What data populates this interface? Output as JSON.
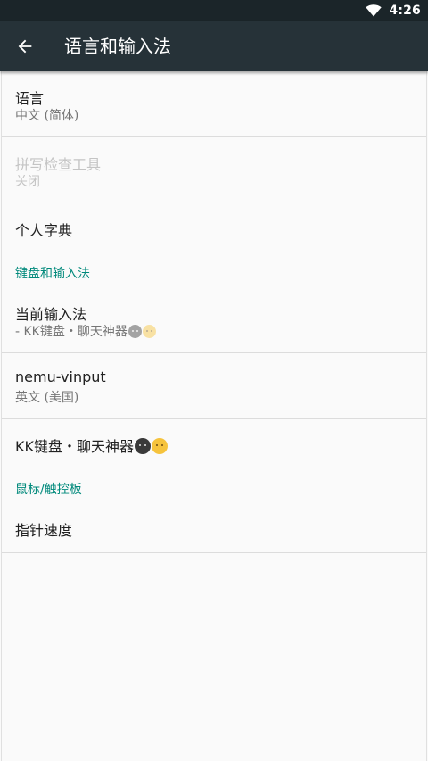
{
  "status_bar": {
    "time": "4:26",
    "icons": [
      "wifi-icon"
    ]
  },
  "app_bar": {
    "title": "语言和输入法",
    "back_icon": "arrow-back-icon"
  },
  "colors": {
    "status_bar": "#1b2529",
    "app_bar": "#263238",
    "accent": "#00897b",
    "background": "#fafafa"
  },
  "prefs": {
    "language": {
      "title": "语言",
      "summary": "中文 (简体)"
    },
    "spellcheck": {
      "title": "拼写检查工具",
      "summary": "关闭",
      "enabled": false
    },
    "dictionary": {
      "title": "个人字典"
    }
  },
  "keyboard_section": {
    "title": "键盘和输入法",
    "current_ime": {
      "title": "当前输入法",
      "summary": "- KK键盘・聊天神器",
      "emoji": [
        "dark-face-emoji",
        "yellow-face-emoji"
      ]
    },
    "nemu": {
      "title": "nemu-vinput",
      "summary": "英文 (美国)"
    },
    "kk": {
      "title": "KK键盘・聊天神器",
      "emoji": [
        "dark-face-emoji",
        "yellow-face-emoji"
      ]
    }
  },
  "pointer_section": {
    "title": "鼠标/触控板",
    "pointer_speed": {
      "title": "指针速度"
    }
  }
}
